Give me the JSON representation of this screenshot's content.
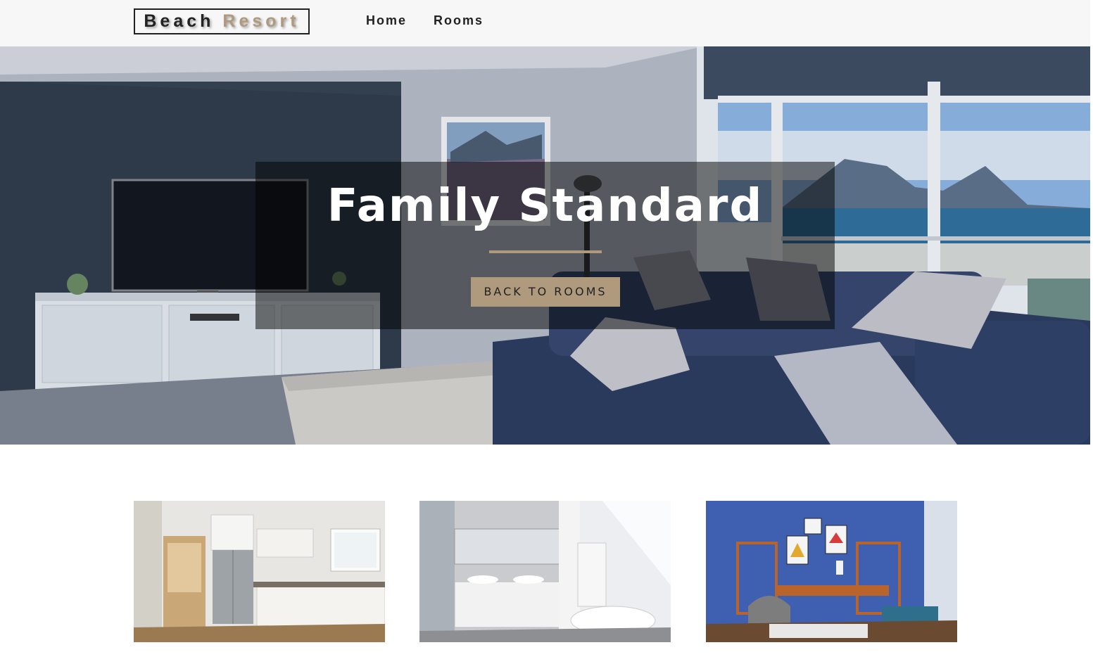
{
  "navbar": {
    "logo_part1": "Beach",
    "logo_part2": "Resort",
    "links": [
      {
        "label": "Home"
      },
      {
        "label": "Rooms"
      }
    ]
  },
  "hero": {
    "title": "Family Standard",
    "button_label": "back to rooms"
  },
  "gallery": {
    "images": [
      {
        "name": "kitchen-photo"
      },
      {
        "name": "bathroom-photo"
      },
      {
        "name": "office-photo"
      }
    ]
  },
  "colors": {
    "accent": "#af9a7d",
    "navbar_bg": "#f7f7f7",
    "text_dark": "#222222"
  }
}
